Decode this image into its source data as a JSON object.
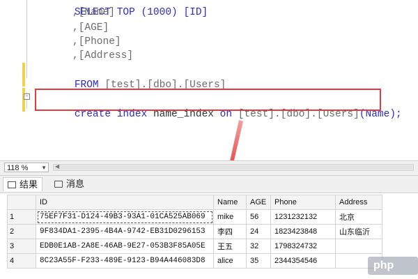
{
  "editor": {
    "lines": [
      {
        "kind": "partial",
        "text": "SELECT TOP (1000) [ID]"
      },
      {
        "kind": "col",
        "text": ",[Name]"
      },
      {
        "kind": "col",
        "text": ",[AGE]"
      },
      {
        "kind": "col",
        "text": ",[Phone]"
      },
      {
        "kind": "col",
        "text": ",[Address]"
      },
      {
        "kind": "from",
        "kw": "FROM",
        "text": "[test].[dbo].[Users]"
      }
    ],
    "statement": {
      "kw1": "create",
      "kw2": "index",
      "name": "name_index",
      "kw3": "on",
      "table": "[test].[dbo].[Users]",
      "paren": "(Name);"
    }
  },
  "status": {
    "zoom": "118 %"
  },
  "tabs": [
    {
      "label": "结果",
      "icon": "grid-icon"
    },
    {
      "label": "消息",
      "icon": "message-icon"
    }
  ],
  "results": {
    "columns": [
      "ID",
      "Name",
      "AGE",
      "Phone",
      "Address"
    ],
    "rows": [
      {
        "n": "1",
        "id": "75EF7F31-D124-49B3-93A1-01CA525AB069",
        "name": "mike",
        "age": "56",
        "phone": "1231232132",
        "addr": "北京"
      },
      {
        "n": "2",
        "id": "9F834DA1-2395-4B4A-9742-EB31D0296153",
        "name": "李四",
        "age": "24",
        "phone": "1823423848",
        "addr": "山东临沂"
      },
      {
        "n": "3",
        "id": "EDB0E1AB-2A8E-46AB-9E27-053B3F85A05E",
        "name": "王五",
        "age": "32",
        "phone": "1798324732",
        "addr": ""
      },
      {
        "n": "4",
        "id": "8C23A55F-F233-489E-9123-B94A446083D8",
        "name": "alice",
        "age": "35",
        "phone": "2344354546",
        "addr": ""
      }
    ]
  },
  "watermark": "php"
}
